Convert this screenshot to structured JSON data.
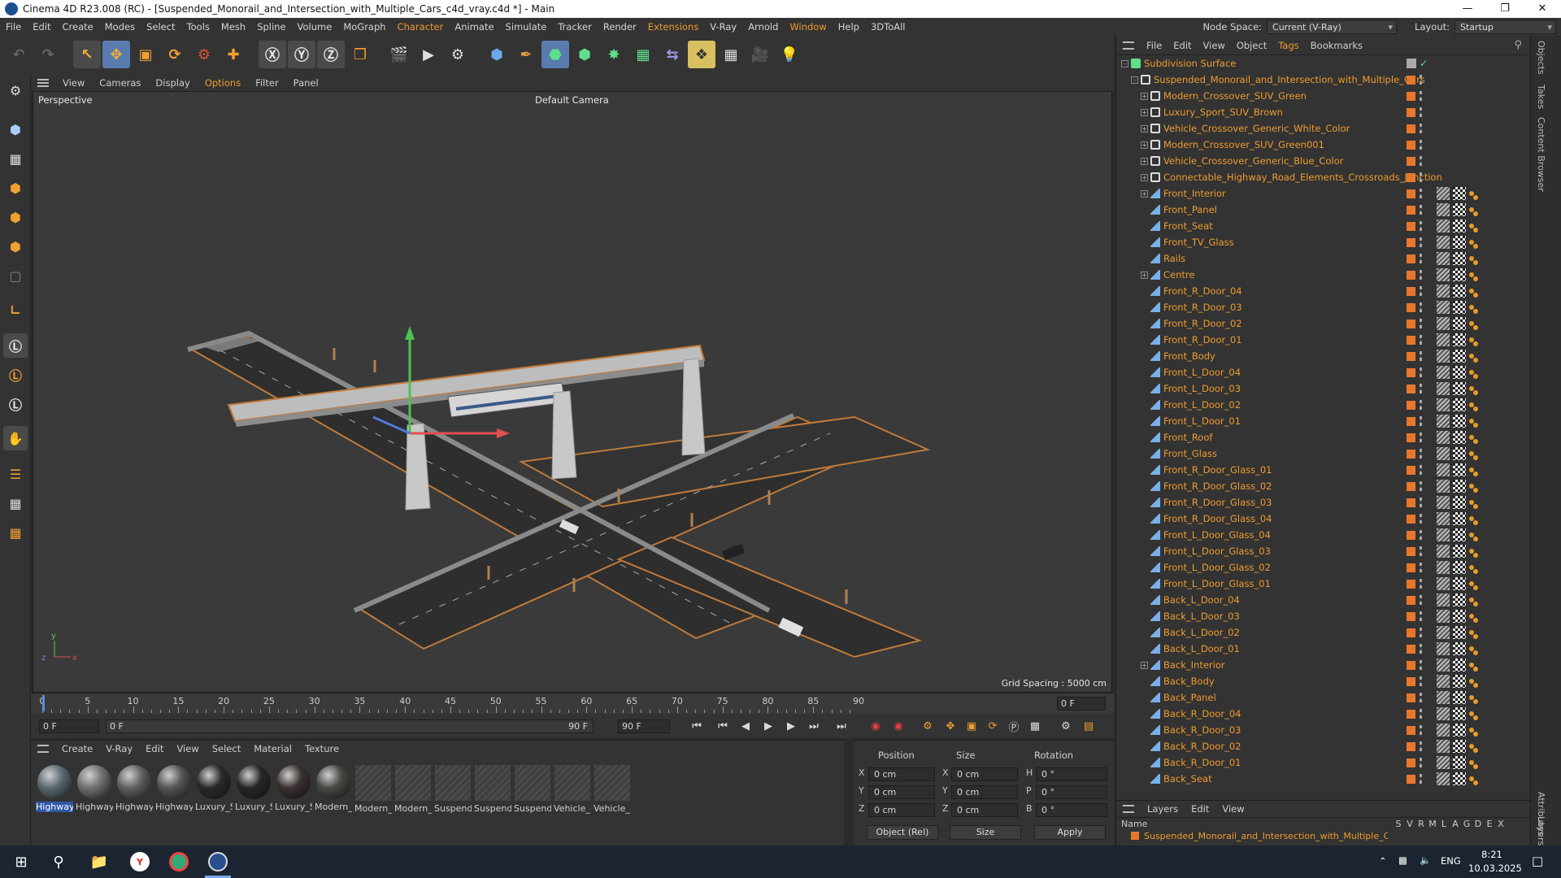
{
  "window": {
    "title": "Cinema 4D R23.008 (RC) - [Suspended_Monorail_and_Intersection_with_Multiple_Cars_c4d_vray.c4d *] - Main",
    "minimize": "—",
    "maximize": "❐",
    "close": "✕"
  },
  "menu": [
    "File",
    "Edit",
    "Create",
    "Modes",
    "Select",
    "Tools",
    "Mesh",
    "Spline",
    "Volume",
    "MoGraph",
    "Character",
    "Animate",
    "Simulate",
    "Tracker",
    "Render",
    "Extensions",
    "V-Ray",
    "Arnold",
    "Window",
    "Help",
    "3DToAll"
  ],
  "menu_highlight": [
    "Character",
    "Extensions",
    "Window"
  ],
  "node_space": {
    "label": "Node Space:",
    "value": "Current (V-Ray)"
  },
  "layout": {
    "label": "Layout:",
    "value": "Startup"
  },
  "viewport_menu": [
    "View",
    "Cameras",
    "Display",
    "Options",
    "Filter",
    "Panel"
  ],
  "viewport": {
    "name": "Perspective",
    "camera": "Default Camera",
    "grid_spacing": "Grid Spacing : 5000 cm"
  },
  "timeline": {
    "ticks": [
      "0",
      "5",
      "10",
      "15",
      "20",
      "25",
      "30",
      "35",
      "40",
      "45",
      "50",
      "55",
      "60",
      "65",
      "70",
      "75",
      "80",
      "85",
      "90"
    ],
    "current_frame": "0 F",
    "end_frame_field": "0 F"
  },
  "transport": {
    "start": "0 F",
    "range_start": "0 F",
    "range_end": "90 F",
    "end": "90 F"
  },
  "material_manager": {
    "menu": [
      "Create",
      "V-Ray",
      "Edit",
      "View",
      "Select",
      "Material",
      "Texture"
    ],
    "materials": [
      {
        "name": "Highway",
        "style": "ball",
        "color": "#5a6a70"
      },
      {
        "name": "Highway",
        "style": "ball",
        "color": "#707070"
      },
      {
        "name": "Highway",
        "style": "ball",
        "color": "#606060"
      },
      {
        "name": "Highway",
        "style": "ball",
        "color": "#555555"
      },
      {
        "name": "Luxury_S",
        "style": "ball",
        "color": "#2a2a2a"
      },
      {
        "name": "Luxury_S",
        "style": "ball",
        "color": "#262626"
      },
      {
        "name": "Luxury_S",
        "style": "ball",
        "color": "#3a3030"
      },
      {
        "name": "Modern_",
        "style": "ball",
        "color": "#474a44"
      },
      {
        "name": "Modern_",
        "style": "blank",
        "color": "#444444"
      },
      {
        "name": "Modern_",
        "style": "blank",
        "color": "#444444"
      },
      {
        "name": "Suspend",
        "style": "blank",
        "color": "#444444"
      },
      {
        "name": "Suspend",
        "style": "blank",
        "color": "#444444"
      },
      {
        "name": "Suspend",
        "style": "blank",
        "color": "#444444"
      },
      {
        "name": "Vehicle_(",
        "style": "blank",
        "color": "#444444"
      },
      {
        "name": "Vehicle_(",
        "style": "blank",
        "color": "#444444"
      }
    ]
  },
  "coordinates": {
    "headers": {
      "position": "Position",
      "size": "Size",
      "rotation": "Rotation"
    },
    "rows": [
      {
        "axis": "X",
        "pos": "0 cm",
        "size_axis": "X",
        "size": "0 cm",
        "rot_axis": "H",
        "rot": "0 °"
      },
      {
        "axis": "Y",
        "pos": "0 cm",
        "size_axis": "Y",
        "size": "0 cm",
        "rot_axis": "P",
        "rot": "0 °"
      },
      {
        "axis": "Z",
        "pos": "0 cm",
        "size_axis": "Z",
        "size": "0 cm",
        "rot_axis": "B",
        "rot": "0 °"
      }
    ],
    "mode": "Object (Rel)",
    "size_mode": "Size",
    "apply": "Apply"
  },
  "object_manager": {
    "menu": [
      "File",
      "Edit",
      "View",
      "Object",
      "Tags",
      "Bookmarks"
    ],
    "menu_highlight": [
      "Tags"
    ],
    "root": "Subdivision Surface",
    "rows": [
      {
        "name": "Suspended_Monorail_and_Intersection_with_Multiple_Cars",
        "depth": 1,
        "exp": "-",
        "kind": "null",
        "tags": false
      },
      {
        "name": "Modern_Crossover_SUV_Green",
        "depth": 2,
        "exp": "+",
        "kind": "null",
        "tags": false
      },
      {
        "name": "Luxury_Sport_SUV_Brown",
        "depth": 2,
        "exp": "+",
        "kind": "null",
        "tags": false
      },
      {
        "name": "Vehicle_Crossover_Generic_White_Color",
        "depth": 2,
        "exp": "+",
        "kind": "null",
        "tags": false
      },
      {
        "name": "Modern_Crossover_SUV_Green001",
        "depth": 2,
        "exp": "+",
        "kind": "null",
        "tags": false
      },
      {
        "name": "Vehicle_Crossover_Generic_Blue_Color",
        "depth": 2,
        "exp": "+",
        "kind": "null",
        "tags": false
      },
      {
        "name": "Connectable_Highway_Road_Elements_Crossroads_Junction",
        "depth": 2,
        "exp": "+",
        "kind": "null",
        "tags": false
      },
      {
        "name": "Front_Interior",
        "depth": 2,
        "exp": "+",
        "kind": "mesh",
        "tags": true
      },
      {
        "name": "Front_Panel",
        "depth": 2,
        "exp": "",
        "kind": "mesh",
        "tags": true
      },
      {
        "name": "Front_Seat",
        "depth": 2,
        "exp": "",
        "kind": "mesh",
        "tags": true
      },
      {
        "name": "Front_TV_Glass",
        "depth": 2,
        "exp": "",
        "kind": "mesh",
        "tags": true
      },
      {
        "name": "Rails",
        "depth": 2,
        "exp": "",
        "kind": "mesh",
        "tags": true
      },
      {
        "name": "Centre",
        "depth": 2,
        "exp": "+",
        "kind": "mesh",
        "tags": true
      },
      {
        "name": "Front_R_Door_04",
        "depth": 2,
        "exp": "",
        "kind": "mesh",
        "tags": true
      },
      {
        "name": "Front_R_Door_03",
        "depth": 2,
        "exp": "",
        "kind": "mesh",
        "tags": true
      },
      {
        "name": "Front_R_Door_02",
        "depth": 2,
        "exp": "",
        "kind": "mesh",
        "tags": true
      },
      {
        "name": "Front_R_Door_01",
        "depth": 2,
        "exp": "",
        "kind": "mesh",
        "tags": true
      },
      {
        "name": "Front_Body",
        "depth": 2,
        "exp": "",
        "kind": "mesh",
        "tags": true
      },
      {
        "name": "Front_L_Door_04",
        "depth": 2,
        "exp": "",
        "kind": "mesh",
        "tags": true
      },
      {
        "name": "Front_L_Door_03",
        "depth": 2,
        "exp": "",
        "kind": "mesh",
        "tags": true
      },
      {
        "name": "Front_L_Door_02",
        "depth": 2,
        "exp": "",
        "kind": "mesh",
        "tags": true
      },
      {
        "name": "Front_L_Door_01",
        "depth": 2,
        "exp": "",
        "kind": "mesh",
        "tags": true
      },
      {
        "name": "Front_Roof",
        "depth": 2,
        "exp": "",
        "kind": "mesh",
        "tags": true
      },
      {
        "name": "Front_Glass",
        "depth": 2,
        "exp": "",
        "kind": "mesh",
        "tags": true
      },
      {
        "name": "Front_R_Door_Glass_01",
        "depth": 2,
        "exp": "",
        "kind": "mesh",
        "tags": true
      },
      {
        "name": "Front_R_Door_Glass_02",
        "depth": 2,
        "exp": "",
        "kind": "mesh",
        "tags": true
      },
      {
        "name": "Front_R_Door_Glass_03",
        "depth": 2,
        "exp": "",
        "kind": "mesh",
        "tags": true
      },
      {
        "name": "Front_R_Door_Glass_04",
        "depth": 2,
        "exp": "",
        "kind": "mesh",
        "tags": true
      },
      {
        "name": "Front_L_Door_Glass_04",
        "depth": 2,
        "exp": "",
        "kind": "mesh",
        "tags": true
      },
      {
        "name": "Front_L_Door_Glass_03",
        "depth": 2,
        "exp": "",
        "kind": "mesh",
        "tags": true
      },
      {
        "name": "Front_L_Door_Glass_02",
        "depth": 2,
        "exp": "",
        "kind": "mesh",
        "tags": true
      },
      {
        "name": "Front_L_Door_Glass_01",
        "depth": 2,
        "exp": "",
        "kind": "mesh",
        "tags": true
      },
      {
        "name": "Back_L_Door_04",
        "depth": 2,
        "exp": "",
        "kind": "mesh",
        "tags": true
      },
      {
        "name": "Back_L_Door_03",
        "depth": 2,
        "exp": "",
        "kind": "mesh",
        "tags": true
      },
      {
        "name": "Back_L_Door_02",
        "depth": 2,
        "exp": "",
        "kind": "mesh",
        "tags": true
      },
      {
        "name": "Back_L_Door_01",
        "depth": 2,
        "exp": "",
        "kind": "mesh",
        "tags": true
      },
      {
        "name": "Back_Interior",
        "depth": 2,
        "exp": "+",
        "kind": "mesh",
        "tags": true
      },
      {
        "name": "Back_Body",
        "depth": 2,
        "exp": "",
        "kind": "mesh",
        "tags": true
      },
      {
        "name": "Back_Panel",
        "depth": 2,
        "exp": "",
        "kind": "mesh",
        "tags": true
      },
      {
        "name": "Back_R_Door_04",
        "depth": 2,
        "exp": "",
        "kind": "mesh",
        "tags": true
      },
      {
        "name": "Back_R_Door_03",
        "depth": 2,
        "exp": "",
        "kind": "mesh",
        "tags": true
      },
      {
        "name": "Back_R_Door_02",
        "depth": 2,
        "exp": "",
        "kind": "mesh",
        "tags": true
      },
      {
        "name": "Back_R_Door_01",
        "depth": 2,
        "exp": "",
        "kind": "mesh",
        "tags": true
      },
      {
        "name": "Back_Seat",
        "depth": 2,
        "exp": "",
        "kind": "mesh",
        "tags": true
      }
    ]
  },
  "layers_panel": {
    "menu": [
      "Layers",
      "Edit",
      "View"
    ],
    "name_header": "Name",
    "columns": [
      "S",
      "V",
      "R",
      "M",
      "L",
      "A",
      "G",
      "D",
      "E",
      "X"
    ],
    "row": "Suspended_Monorail_and_Intersection_with_Multiple_Cars"
  },
  "side_tabs": [
    "Objects",
    "Takes",
    "Content Browser"
  ],
  "side_tabs_lower": [
    "Attributes",
    "Layers"
  ],
  "taskbar": {
    "lang": "ENG",
    "time": "8:21",
    "date": "10.03.2025"
  },
  "colors": {
    "accent_orange": "#ee9c2e",
    "panel": "#333333",
    "viewport": "#3a3a3a",
    "selection_blue": "#2f57a8"
  }
}
